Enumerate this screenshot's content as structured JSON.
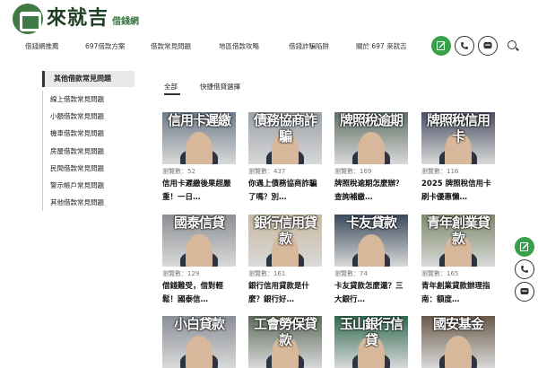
{
  "brand": {
    "name": "來就吉",
    "sub": "借錢網"
  },
  "nav": {
    "items": [
      "借錢網推薦",
      "697借款方案",
      "借款常見問題",
      "地區借款攻略",
      "借錢詐騙陷阱",
      "關於 697 來就吉"
    ],
    "actions": [
      {
        "icon": "edit-icon",
        "color": "#39a04a"
      },
      {
        "icon": "phone-icon",
        "color": "#ffffff"
      },
      {
        "icon": "line-icon",
        "color": "#ffffff"
      }
    ]
  },
  "sidebar": {
    "title": "其他借款常見問題",
    "items": [
      "線上借款常見問題",
      "小額借款常見問題",
      "機車借款常見問題",
      "房屋借款常見問題",
      "民間借款常見問題",
      "警示帳戶常見問題",
      "其他借款常見問題"
    ]
  },
  "tabs": [
    "全部",
    "快捷借貸選擇"
  ],
  "cards": [
    {
      "banner": "信用卡遲繳",
      "views": "瀏覽數：52",
      "title": "信用卡遲繳後果超嚴重！一日…",
      "color": "#6d7b8a"
    },
    {
      "banner": "債務協商詐騙",
      "views": "瀏覽數：437",
      "title": "你遇上債務協商詐騙了嗎？別…",
      "color": "#9aa1a8"
    },
    {
      "banner": "牌照稅逾期",
      "views": "瀏覽數：169",
      "title": "牌照稅逾期怎麼辦？查詢補繳…",
      "color": "#5f6f62"
    },
    {
      "banner": "牌照稅信用卡",
      "views": "瀏覽數：116",
      "title": "2025 牌照稅信用卡刷卡優惠懶…",
      "color": "#4a4f63"
    },
    {
      "banner": "國泰信貸",
      "views": "瀏覽數：129",
      "title": "借錢難受，借對輕鬆！國泰信…",
      "color": "#8b8f94"
    },
    {
      "banner": "銀行信用貸款",
      "views": "瀏覽數：161",
      "title": "銀行信用貸款是什麼？銀行好…",
      "color": "#c9b9a0"
    },
    {
      "banner": "卡友貸款",
      "views": "瀏覽數：74",
      "title": "卡友貸款怎麼還？三大銀行…",
      "color": "#3a4a5c"
    },
    {
      "banner": "青年創業貸款",
      "views": "瀏覽數：165",
      "title": "青年創業貸款辦理指南：額度…",
      "color": "#7d8a6a"
    },
    {
      "banner": "小白貸款",
      "views": "",
      "title": "",
      "color": "#8a8f97"
    },
    {
      "banner": "工會勞保貸款",
      "views": "",
      "title": "",
      "color": "#5d6b5a"
    },
    {
      "banner": "玉山銀行信貸",
      "views": "",
      "title": "",
      "color": "#2f6a4f"
    },
    {
      "banner": "國安基金",
      "views": "",
      "title": "",
      "color": "#6a5a4a"
    }
  ],
  "floating": [
    {
      "icon": "edit-icon",
      "color": "#39a04a"
    },
    {
      "icon": "phone-icon",
      "color": "#ffffff"
    },
    {
      "icon": "line-icon",
      "color": "#ffffff"
    }
  ]
}
